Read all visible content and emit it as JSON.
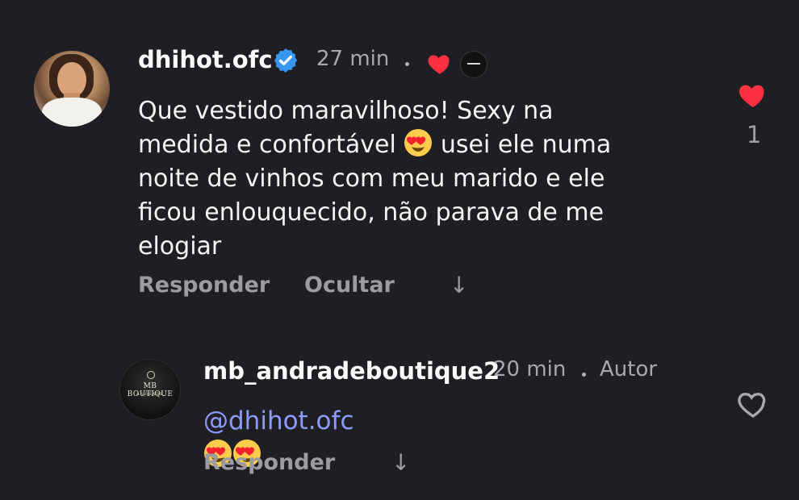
{
  "comment": {
    "username": "dhihot.ofc",
    "time": "27 min",
    "text_line1": "Que vestido maravilhoso! Sexy na",
    "text_line2_before_emoji": "medida e confortável ",
    "text_line2_after_emoji": " usei ele numa",
    "text_line3": "noite de vinhos com meu marido e ele",
    "text_line4": "ficou enlouquecido, não parava de me",
    "text_line5": "elogiar",
    "reply_label": "Responder",
    "hide_label": "Ocultar",
    "like_count": "1",
    "accent_color": "#ff3040"
  },
  "reply": {
    "username": "mb_andradeboutique2",
    "time": "20 min",
    "author_badge": "Autor",
    "mention": "@dhihot.ofc",
    "reply_label": "Responder",
    "avatar_text_top": "MB BOUTIQUE",
    "avatar_text_bottom": "ANDRADE"
  }
}
